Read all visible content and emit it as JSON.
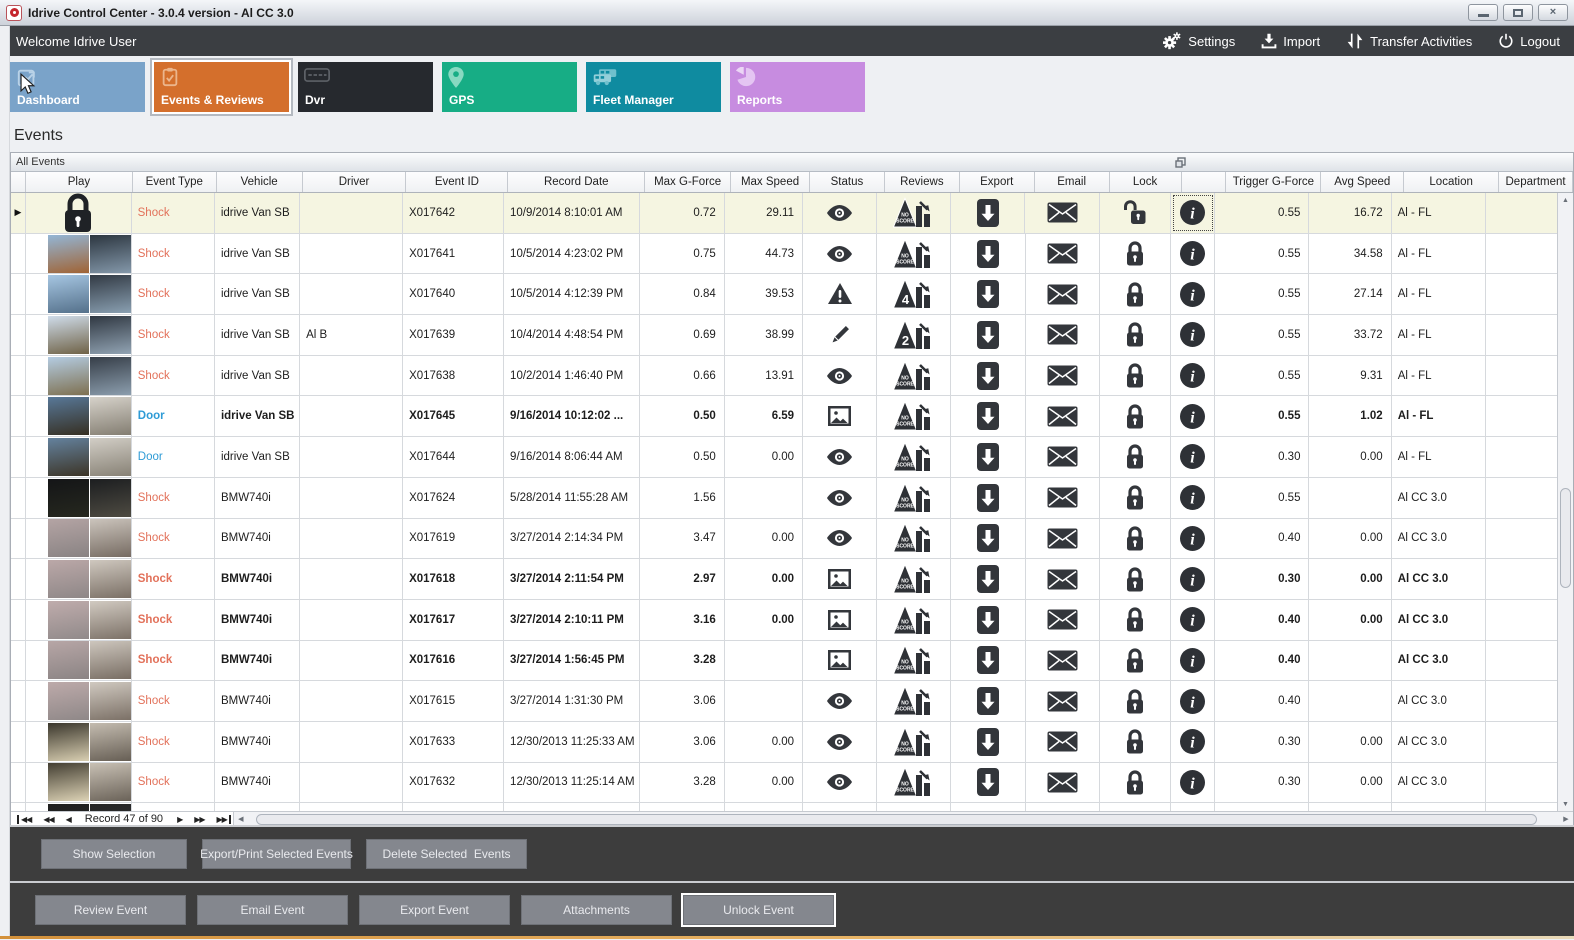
{
  "titlebar": {
    "title": "Idrive Control Center - 3.0.4 version - Al CC 3.0",
    "buttons": [
      {
        "name": "minimize-button",
        "glyph": "min"
      },
      {
        "name": "maximize-button",
        "glyph": "max"
      },
      {
        "name": "close-button",
        "glyph": "close"
      }
    ]
  },
  "menubar": {
    "welcome": "Welcome Idrive User",
    "actions": [
      {
        "name": "settings-button",
        "label": "Settings",
        "icon": "gear-icon"
      },
      {
        "name": "import-button",
        "label": "Import",
        "icon": "import-icon"
      },
      {
        "name": "transfer-activities-button",
        "label": "Transfer Activities",
        "icon": "transfer-icon"
      },
      {
        "name": "logout-button",
        "label": "Logout",
        "icon": "power-icon"
      }
    ]
  },
  "tabs": [
    {
      "id": "dashboard",
      "label": "Dashboard",
      "color": "#7aa3c9",
      "icon": "dashboard-icon",
      "selected": false
    },
    {
      "id": "events-reviews",
      "label": "Events & Reviews",
      "color": "#d46f2c",
      "icon": "clipboard-check-icon",
      "selected": true
    },
    {
      "id": "dvr",
      "label": "Dvr",
      "color": "#26292e",
      "icon": "dvr-icon",
      "selected": false
    },
    {
      "id": "gps",
      "label": "GPS",
      "color": "#17ad85",
      "icon": "map-pin-icon",
      "selected": false
    },
    {
      "id": "fleet-manager",
      "label": "Fleet Manager",
      "color": "#0f8ba0",
      "icon": "trucks-icon",
      "selected": false
    },
    {
      "id": "reports",
      "label": "Reports",
      "color": "#c78ce0",
      "icon": "pie-chart-icon",
      "selected": false
    }
  ],
  "page": {
    "heading": "Events"
  },
  "panel": {
    "title": "All Events"
  },
  "grid": {
    "columns": [
      {
        "key": "selector",
        "label": ""
      },
      {
        "key": "play",
        "label": "Play"
      },
      {
        "key": "event-type",
        "label": "Event Type"
      },
      {
        "key": "vehicle",
        "label": "Vehicle"
      },
      {
        "key": "driver",
        "label": "Driver"
      },
      {
        "key": "event-id",
        "label": "Event ID"
      },
      {
        "key": "record-date",
        "label": "Record Date"
      },
      {
        "key": "max-g-force",
        "label": "Max G-Force"
      },
      {
        "key": "max-speed",
        "label": "Max Speed"
      },
      {
        "key": "status",
        "label": "Status"
      },
      {
        "key": "reviews",
        "label": "Reviews"
      },
      {
        "key": "export",
        "label": "Export"
      },
      {
        "key": "email",
        "label": "Email"
      },
      {
        "key": "lock",
        "label": "Lock"
      },
      {
        "key": "info",
        "label": ""
      },
      {
        "key": "trigger-g-force",
        "label": "Trigger G-Force"
      },
      {
        "key": "avg-speed",
        "label": "Avg Speed"
      },
      {
        "key": "location",
        "label": "Location"
      },
      {
        "key": "department",
        "label": "Department"
      }
    ],
    "rows": [
      {
        "selected": true,
        "bold": false,
        "play": "lock",
        "thumb": null,
        "event_type": "Shock",
        "type": "shock",
        "vehicle": "idrive Van SB",
        "driver": "",
        "event_id": "X017642",
        "record_date": "10/9/2014 8:10:01 AM",
        "max_g": "0.72",
        "max_speed": "29.11",
        "status_icon": "eye-icon",
        "review_badge": "NO SCORE",
        "lock_icon": "lock-open-icon",
        "info_focused": true,
        "trigger_g": "0.55",
        "avg_speed": "16.72",
        "location": "Al - FL",
        "department": ""
      },
      {
        "selected": false,
        "bold": false,
        "play": "thumb",
        "thumb": {
          "l": [
            "#93b6d6",
            "#a06334"
          ],
          "r": [
            "#2c3640",
            "#8498aa"
          ]
        },
        "event_type": "Shock",
        "type": "shock",
        "vehicle": "idrive Van SB",
        "driver": "",
        "event_id": "X017641",
        "record_date": "10/5/2014 4:23:02 PM",
        "max_g": "0.75",
        "max_speed": "44.73",
        "status_icon": "eye-icon",
        "review_badge": "NO SCORE",
        "lock_icon": "lock-closed-icon",
        "info_focused": false,
        "trigger_g": "0.55",
        "avg_speed": "34.58",
        "location": "Al - FL",
        "department": ""
      },
      {
        "selected": false,
        "bold": false,
        "play": "thumb",
        "thumb": {
          "l": [
            "#a6c6e2",
            "#54708a"
          ],
          "r": [
            "#323a44",
            "#8aa0b2"
          ]
        },
        "event_type": "Shock",
        "type": "shock",
        "vehicle": "idrive Van SB",
        "driver": "",
        "event_id": "X017640",
        "record_date": "10/5/2014 4:12:39 PM",
        "max_g": "0.84",
        "max_speed": "39.53",
        "status_icon": "warning-icon",
        "review_badge": "4",
        "lock_icon": "lock-closed-icon",
        "info_focused": false,
        "trigger_g": "0.55",
        "avg_speed": "27.14",
        "location": "Al - FL",
        "department": ""
      },
      {
        "selected": false,
        "bold": false,
        "play": "thumb",
        "thumb": {
          "l": [
            "#cfdcea",
            "#6f6246"
          ],
          "r": [
            "#303842",
            "#92a4b4"
          ]
        },
        "event_type": "Shock",
        "type": "shock",
        "vehicle": "idrive Van SB",
        "driver": "Al B",
        "event_id": "X017639",
        "record_date": "10/4/2014 4:48:54 PM",
        "max_g": "0.69",
        "max_speed": "38.99",
        "status_icon": "pencil-icon",
        "review_badge": "2",
        "lock_icon": "lock-closed-icon",
        "info_focused": false,
        "trigger_g": "0.55",
        "avg_speed": "33.72",
        "location": "Al - FL",
        "department": ""
      },
      {
        "selected": false,
        "bold": false,
        "play": "thumb",
        "thumb": {
          "l": [
            "#b4cce2",
            "#7e7050"
          ],
          "r": [
            "#363e48",
            "#8c9eae"
          ]
        },
        "event_type": "Shock",
        "type": "shock",
        "vehicle": "idrive Van SB",
        "driver": "",
        "event_id": "X017638",
        "record_date": "10/2/2014 1:46:40 PM",
        "max_g": "0.66",
        "max_speed": "13.91",
        "status_icon": "eye-icon",
        "review_badge": "NO SCORE",
        "lock_icon": "lock-closed-icon",
        "info_focused": false,
        "trigger_g": "0.55",
        "avg_speed": "9.31",
        "location": "Al - FL",
        "department": ""
      },
      {
        "selected": false,
        "bold": true,
        "play": "thumb",
        "thumb": {
          "l": [
            "#587898",
            "#362f22"
          ],
          "r": [
            "#d6d2ca",
            "#837d71"
          ]
        },
        "event_type": "Door",
        "type": "door",
        "vehicle": "idrive Van SB",
        "driver": "",
        "event_id": "X017645",
        "record_date": "9/16/2014 10:12:02 ...",
        "max_g": "0.50",
        "max_speed": "6.59",
        "status_icon": "picture-icon",
        "review_badge": "NO SCORE",
        "lock_icon": "lock-closed-icon",
        "info_focused": false,
        "trigger_g": "0.55",
        "avg_speed": "1.02",
        "location": "Al - FL",
        "department": ""
      },
      {
        "selected": false,
        "bold": false,
        "play": "thumb",
        "thumb": {
          "l": [
            "#64829e",
            "#3c3426"
          ],
          "r": [
            "#d2cec6",
            "#878175"
          ]
        },
        "event_type": "Door",
        "type": "door",
        "vehicle": "idrive Van SB",
        "driver": "",
        "event_id": "X017644",
        "record_date": "9/16/2014 8:06:44 AM",
        "max_g": "0.50",
        "max_speed": "0.00",
        "status_icon": "eye-icon",
        "review_badge": "NO SCORE",
        "lock_icon": "lock-closed-icon",
        "info_focused": false,
        "trigger_g": "0.30",
        "avg_speed": "0.00",
        "location": "Al - FL",
        "department": ""
      },
      {
        "selected": false,
        "bold": false,
        "play": "thumb",
        "thumb": {
          "l": [
            "#141517",
            "#26281f"
          ],
          "r": [
            "#1c1e20",
            "#4e4b42"
          ]
        },
        "event_type": "Shock",
        "type": "shock",
        "vehicle": "BMW740i",
        "driver": "",
        "event_id": "X017624",
        "record_date": "5/28/2014 11:55:28 AM",
        "max_g": "1.56",
        "max_speed": "",
        "status_icon": "eye-icon",
        "review_badge": "NO SCORE",
        "lock_icon": "lock-closed-icon",
        "info_focused": false,
        "trigger_g": "0.55",
        "avg_speed": "",
        "location": "Al CC 3.0",
        "department": ""
      },
      {
        "selected": false,
        "bold": false,
        "play": "thumb",
        "thumb": {
          "l": [
            "#b4a4a4",
            "#898383"
          ],
          "r": [
            "#cbc4bc",
            "#766b62"
          ]
        },
        "event_type": "Shock",
        "type": "shock",
        "vehicle": "BMW740i",
        "driver": "",
        "event_id": "X017619",
        "record_date": "3/27/2014 2:14:34 PM",
        "max_g": "3.47",
        "max_speed": "0.00",
        "status_icon": "eye-icon",
        "review_badge": "NO SCORE",
        "lock_icon": "lock-closed-icon",
        "info_focused": false,
        "trigger_g": "0.40",
        "avg_speed": "0.00",
        "location": "Al CC 3.0",
        "department": ""
      },
      {
        "selected": false,
        "bold": true,
        "play": "thumb",
        "thumb": {
          "l": [
            "#bba8a8",
            "#8e8787"
          ],
          "r": [
            "#cfc8bf",
            "#7a6f65"
          ]
        },
        "event_type": "Shock",
        "type": "shock",
        "vehicle": "BMW740i",
        "driver": "",
        "event_id": "X017618",
        "record_date": "3/27/2014 2:11:54 PM",
        "max_g": "2.97",
        "max_speed": "0.00",
        "status_icon": "picture-icon",
        "review_badge": "NO SCORE",
        "lock_icon": "lock-closed-icon",
        "info_focused": false,
        "trigger_g": "0.30",
        "avg_speed": "0.00",
        "location": "Al CC 3.0",
        "department": ""
      },
      {
        "selected": false,
        "bold": true,
        "play": "thumb",
        "thumb": {
          "l": [
            "#bfacac",
            "#918a8a"
          ],
          "r": [
            "#d1cac1",
            "#7c7167"
          ]
        },
        "event_type": "Shock",
        "type": "shock",
        "vehicle": "BMW740i",
        "driver": "",
        "event_id": "X017617",
        "record_date": "3/27/2014 2:10:11 PM",
        "max_g": "3.16",
        "max_speed": "0.00",
        "status_icon": "picture-icon",
        "review_badge": "NO SCORE",
        "lock_icon": "lock-closed-icon",
        "info_focused": false,
        "trigger_g": "0.40",
        "avg_speed": "0.00",
        "location": "Al CC 3.0",
        "department": ""
      },
      {
        "selected": false,
        "bold": true,
        "play": "thumb",
        "thumb": {
          "l": [
            "#b7a6a6",
            "#8b8484"
          ],
          "r": [
            "#cdc6bd",
            "#786d63"
          ]
        },
        "event_type": "Shock",
        "type": "shock",
        "vehicle": "BMW740i",
        "driver": "",
        "event_id": "X017616",
        "record_date": "3/27/2014 1:56:45 PM",
        "max_g": "3.28",
        "max_speed": "",
        "status_icon": "picture-icon",
        "review_badge": "NO SCORE",
        "lock_icon": "lock-closed-icon",
        "info_focused": false,
        "trigger_g": "0.40",
        "avg_speed": "",
        "location": "Al CC 3.0",
        "department": ""
      },
      {
        "selected": false,
        "bold": false,
        "play": "thumb",
        "thumb": {
          "l": [
            "#bdaaaa",
            "#8f8888"
          ],
          "r": [
            "#d0c9c0",
            "#7b7066"
          ]
        },
        "event_type": "Shock",
        "type": "shock",
        "vehicle": "BMW740i",
        "driver": "",
        "event_id": "X017615",
        "record_date": "3/27/2014 1:31:30 PM",
        "max_g": "3.06",
        "max_speed": "",
        "status_icon": "eye-icon",
        "review_badge": "NO SCORE",
        "lock_icon": "lock-closed-icon",
        "info_focused": false,
        "trigger_g": "0.40",
        "avg_speed": "",
        "location": "Al CC 3.0",
        "department": ""
      },
      {
        "selected": false,
        "bold": false,
        "play": "thumb",
        "thumb": {
          "l": [
            "#3a362c",
            "#d9cfb2"
          ],
          "r": [
            "#c4bcb0",
            "#665e54"
          ]
        },
        "event_type": "Shock",
        "type": "shock",
        "vehicle": "BMW740i",
        "driver": "",
        "event_id": "X017633",
        "record_date": "12/30/2013 11:25:33 AM",
        "max_g": "3.06",
        "max_speed": "0.00",
        "status_icon": "eye-icon",
        "review_badge": "NO SCORE",
        "lock_icon": "lock-closed-icon",
        "info_focused": false,
        "trigger_g": "0.30",
        "avg_speed": "0.00",
        "location": "Al CC 3.0",
        "department": ""
      },
      {
        "selected": false,
        "bold": false,
        "play": "thumb",
        "thumb": {
          "l": [
            "#433e32",
            "#ddd3b6"
          ],
          "r": [
            "#c8c0b4",
            "#6a6258"
          ]
        },
        "event_type": "Shock",
        "type": "shock",
        "vehicle": "BMW740i",
        "driver": "",
        "event_id": "X017632",
        "record_date": "12/30/2013 11:25:14 AM",
        "max_g": "3.28",
        "max_speed": "0.00",
        "status_icon": "eye-icon",
        "review_badge": "NO SCORE",
        "lock_icon": "lock-closed-icon",
        "info_focused": false,
        "trigger_g": "0.30",
        "avg_speed": "0.00",
        "location": "Al CC 3.0",
        "department": ""
      },
      {
        "selected": false,
        "bold": false,
        "play": "thumb",
        "thumb": {
          "l": [
            "#1e1e1e",
            "#2e2e2e"
          ],
          "r": [
            "#262626",
            "#363636"
          ]
        },
        "event_type": "",
        "type": "shock",
        "vehicle": "",
        "driver": "",
        "event_id": "",
        "record_date": "",
        "max_g": "",
        "max_speed": "",
        "status_icon": "",
        "review_badge": "",
        "lock_icon": "",
        "info_focused": false,
        "trigger_g": "",
        "avg_speed": "",
        "location": "",
        "department": ""
      }
    ]
  },
  "navigator": {
    "label": "Record 47 of 90",
    "controls_left": [
      {
        "name": "first-record-button",
        "glyph": "◀◀",
        "edge": "L"
      },
      {
        "name": "prev-page-button",
        "glyph": "◀◀",
        "edge": ""
      },
      {
        "name": "prev-record-button",
        "glyph": "◀",
        "edge": ""
      }
    ],
    "controls_right": [
      {
        "name": "next-record-button",
        "glyph": "▶",
        "edge": ""
      },
      {
        "name": "next-page-button",
        "glyph": "▶▶",
        "edge": ""
      },
      {
        "name": "last-record-button",
        "glyph": "▶▶",
        "edge": "R"
      }
    ]
  },
  "footer": {
    "selection_buttons": [
      {
        "name": "show-selection-button",
        "label": "Show Selection",
        "focused": false
      },
      {
        "name": "export-print-selected-events-button",
        "label": "Export/Print Selected Events",
        "focused": false
      },
      {
        "name": "delete-selected-events-button",
        "label": "Delete Selected  Events",
        "focused": false
      }
    ],
    "event_buttons": [
      {
        "name": "review-event-button",
        "label": "Review Event",
        "focused": false
      },
      {
        "name": "email-event-button",
        "label": "Email Event",
        "focused": false
      },
      {
        "name": "export-event-button",
        "label": "Export Event",
        "focused": false
      },
      {
        "name": "attachments-button",
        "label": "Attachments",
        "focused": false
      },
      {
        "name": "unlock-event-button",
        "label": "Unlock Event",
        "focused": true
      }
    ]
  },
  "colors": {
    "selected_row": "#f5f5e1",
    "shock_text": "#e2715a",
    "door_text": "#2e9bd6",
    "accent_orange": "#d46f2c",
    "menubar_bg": "#3b3e42",
    "panel_bg": "#3d3d3d",
    "bottom_strip": "#d3913b"
  }
}
